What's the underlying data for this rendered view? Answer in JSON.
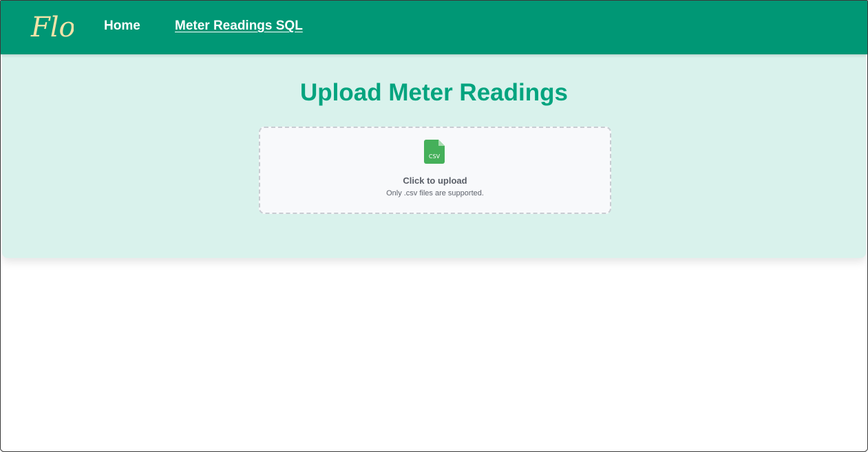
{
  "nav": {
    "logo_text": "Flo",
    "logo_color": "#f3e3a8",
    "links": [
      {
        "label": "Home",
        "active": false
      },
      {
        "label": "Meter Readings SQL",
        "active": true
      }
    ]
  },
  "main": {
    "title": "Upload Meter Readings",
    "upload": {
      "icon": "csv-file-icon",
      "icon_text": "CSV",
      "label": "Click to upload",
      "hint": "Only .csv files are supported."
    }
  },
  "colors": {
    "navbar": "#009775",
    "panel": "#d9f2ec",
    "title": "#05a47f",
    "csv_icon": "#45b05a"
  }
}
